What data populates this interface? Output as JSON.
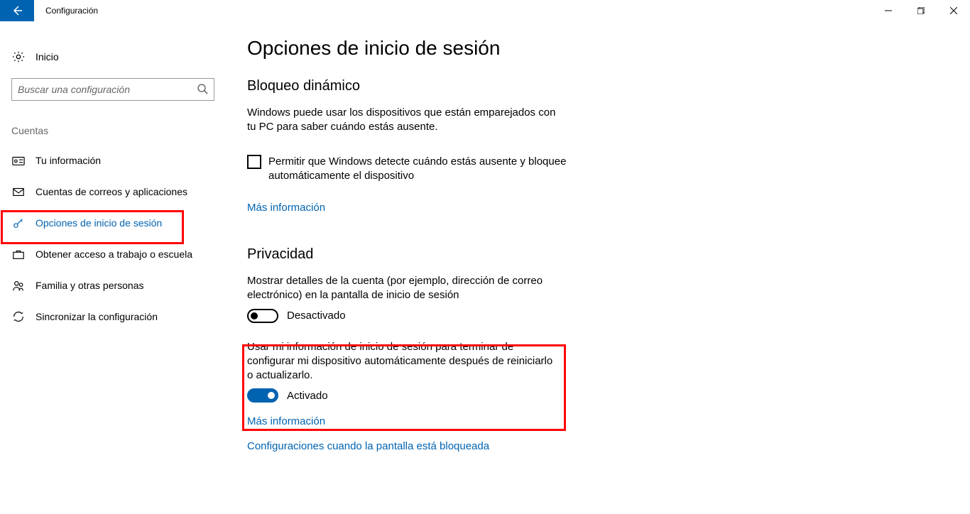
{
  "window": {
    "title": "Configuración"
  },
  "sidebar": {
    "home": "Inicio",
    "search_placeholder": "Buscar una configuración",
    "section": "Cuentas",
    "items": [
      {
        "label": "Tu información"
      },
      {
        "label": "Cuentas de correos y aplicaciones"
      },
      {
        "label": "Opciones de inicio de sesión"
      },
      {
        "label": "Obtener acceso a trabajo o escuela"
      },
      {
        "label": "Familia y otras personas"
      },
      {
        "label": "Sincronizar la configuración"
      }
    ]
  },
  "main": {
    "title": "Opciones de inicio de sesión",
    "dynamic_lock": {
      "heading": "Bloqueo dinámico",
      "desc": "Windows puede usar los dispositivos que están emparejados con tu PC para saber cuándo estás ausente.",
      "checkbox_label": "Permitir que Windows detecte cuándo estás ausente y bloquee automáticamente el dispositivo",
      "more_info": "Más información"
    },
    "privacy": {
      "heading": "Privacidad",
      "desc1": "Mostrar detalles de la cuenta (por ejemplo, dirección de correo electrónico) en la pantalla de inicio de sesión",
      "toggle1_state": "Desactivado",
      "desc2": "Usar mi información de inicio de sesión para terminar de configurar mi dispositivo automáticamente después de reiniciarlo o actualizarlo.",
      "toggle2_state": "Activado",
      "more_info": "Más información",
      "lockscreen_link": "Configuraciones cuando la pantalla está bloqueada"
    }
  }
}
